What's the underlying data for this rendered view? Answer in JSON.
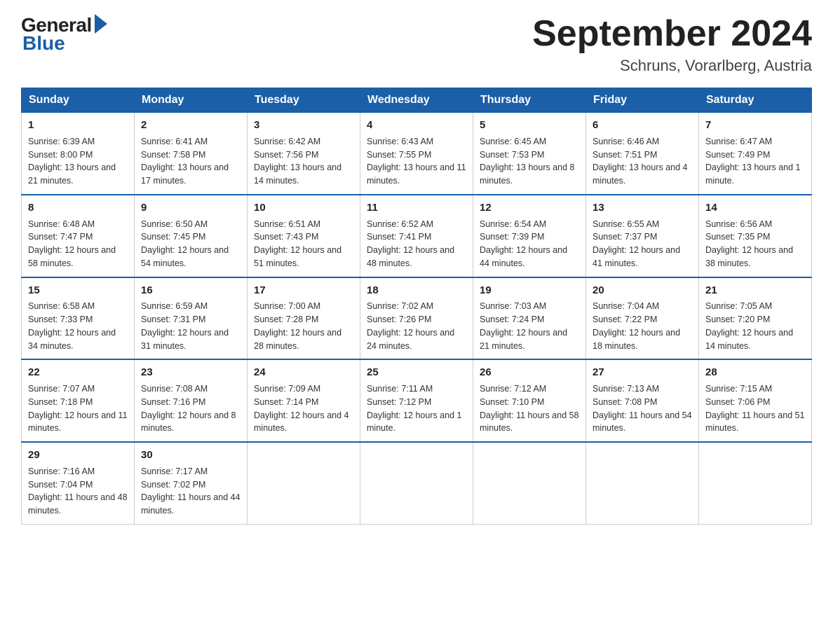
{
  "header": {
    "logo_general": "General",
    "logo_blue": "Blue",
    "month_year": "September 2024",
    "location": "Schruns, Vorarlberg, Austria"
  },
  "weekdays": [
    "Sunday",
    "Monday",
    "Tuesday",
    "Wednesday",
    "Thursday",
    "Friday",
    "Saturday"
  ],
  "weeks": [
    [
      {
        "day": "1",
        "sunrise": "6:39 AM",
        "sunset": "8:00 PM",
        "daylight": "13 hours and 21 minutes."
      },
      {
        "day": "2",
        "sunrise": "6:41 AM",
        "sunset": "7:58 PM",
        "daylight": "13 hours and 17 minutes."
      },
      {
        "day": "3",
        "sunrise": "6:42 AM",
        "sunset": "7:56 PM",
        "daylight": "13 hours and 14 minutes."
      },
      {
        "day": "4",
        "sunrise": "6:43 AM",
        "sunset": "7:55 PM",
        "daylight": "13 hours and 11 minutes."
      },
      {
        "day": "5",
        "sunrise": "6:45 AM",
        "sunset": "7:53 PM",
        "daylight": "13 hours and 8 minutes."
      },
      {
        "day": "6",
        "sunrise": "6:46 AM",
        "sunset": "7:51 PM",
        "daylight": "13 hours and 4 minutes."
      },
      {
        "day": "7",
        "sunrise": "6:47 AM",
        "sunset": "7:49 PM",
        "daylight": "13 hours and 1 minute."
      }
    ],
    [
      {
        "day": "8",
        "sunrise": "6:48 AM",
        "sunset": "7:47 PM",
        "daylight": "12 hours and 58 minutes."
      },
      {
        "day": "9",
        "sunrise": "6:50 AM",
        "sunset": "7:45 PM",
        "daylight": "12 hours and 54 minutes."
      },
      {
        "day": "10",
        "sunrise": "6:51 AM",
        "sunset": "7:43 PM",
        "daylight": "12 hours and 51 minutes."
      },
      {
        "day": "11",
        "sunrise": "6:52 AM",
        "sunset": "7:41 PM",
        "daylight": "12 hours and 48 minutes."
      },
      {
        "day": "12",
        "sunrise": "6:54 AM",
        "sunset": "7:39 PM",
        "daylight": "12 hours and 44 minutes."
      },
      {
        "day": "13",
        "sunrise": "6:55 AM",
        "sunset": "7:37 PM",
        "daylight": "12 hours and 41 minutes."
      },
      {
        "day": "14",
        "sunrise": "6:56 AM",
        "sunset": "7:35 PM",
        "daylight": "12 hours and 38 minutes."
      }
    ],
    [
      {
        "day": "15",
        "sunrise": "6:58 AM",
        "sunset": "7:33 PM",
        "daylight": "12 hours and 34 minutes."
      },
      {
        "day": "16",
        "sunrise": "6:59 AM",
        "sunset": "7:31 PM",
        "daylight": "12 hours and 31 minutes."
      },
      {
        "day": "17",
        "sunrise": "7:00 AM",
        "sunset": "7:28 PM",
        "daylight": "12 hours and 28 minutes."
      },
      {
        "day": "18",
        "sunrise": "7:02 AM",
        "sunset": "7:26 PM",
        "daylight": "12 hours and 24 minutes."
      },
      {
        "day": "19",
        "sunrise": "7:03 AM",
        "sunset": "7:24 PM",
        "daylight": "12 hours and 21 minutes."
      },
      {
        "day": "20",
        "sunrise": "7:04 AM",
        "sunset": "7:22 PM",
        "daylight": "12 hours and 18 minutes."
      },
      {
        "day": "21",
        "sunrise": "7:05 AM",
        "sunset": "7:20 PM",
        "daylight": "12 hours and 14 minutes."
      }
    ],
    [
      {
        "day": "22",
        "sunrise": "7:07 AM",
        "sunset": "7:18 PM",
        "daylight": "12 hours and 11 minutes."
      },
      {
        "day": "23",
        "sunrise": "7:08 AM",
        "sunset": "7:16 PM",
        "daylight": "12 hours and 8 minutes."
      },
      {
        "day": "24",
        "sunrise": "7:09 AM",
        "sunset": "7:14 PM",
        "daylight": "12 hours and 4 minutes."
      },
      {
        "day": "25",
        "sunrise": "7:11 AM",
        "sunset": "7:12 PM",
        "daylight": "12 hours and 1 minute."
      },
      {
        "day": "26",
        "sunrise": "7:12 AM",
        "sunset": "7:10 PM",
        "daylight": "11 hours and 58 minutes."
      },
      {
        "day": "27",
        "sunrise": "7:13 AM",
        "sunset": "7:08 PM",
        "daylight": "11 hours and 54 minutes."
      },
      {
        "day": "28",
        "sunrise": "7:15 AM",
        "sunset": "7:06 PM",
        "daylight": "11 hours and 51 minutes."
      }
    ],
    [
      {
        "day": "29",
        "sunrise": "7:16 AM",
        "sunset": "7:04 PM",
        "daylight": "11 hours and 48 minutes."
      },
      {
        "day": "30",
        "sunrise": "7:17 AM",
        "sunset": "7:02 PM",
        "daylight": "11 hours and 44 minutes."
      },
      null,
      null,
      null,
      null,
      null
    ]
  ]
}
